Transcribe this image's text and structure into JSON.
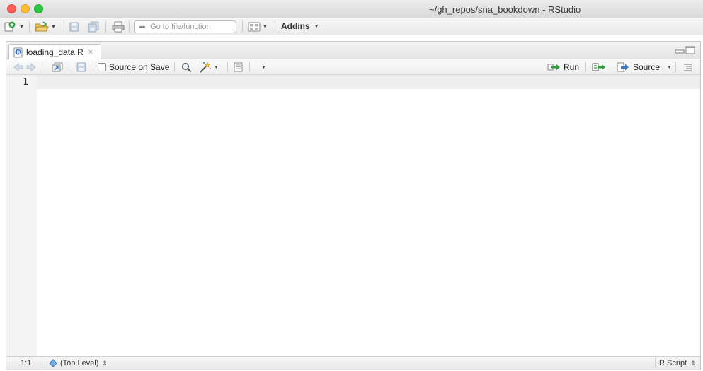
{
  "window": {
    "title": "~/gh_repos/sna_bookdown - RStudio"
  },
  "toolbar": {
    "goto_placeholder": "Go to file/function",
    "addins_label": "Addins",
    "icons": [
      "new-file-icon",
      "open-folder-icon",
      "save-icon",
      "save-all-icon",
      "print-icon",
      "workspace-panes-icon"
    ]
  },
  "editor_tab": {
    "filename": "loading_data.R",
    "close": "×"
  },
  "editor_toolbar": {
    "source_on_save": "Source on Save",
    "run": "Run",
    "source": "Source"
  },
  "editor": {
    "line_numbers": [
      "1"
    ]
  },
  "statusbar": {
    "position": "1:1",
    "scope": "(Top Level)",
    "filetype": "R Script"
  },
  "colors": {
    "accent_green": "#2e9e3e",
    "accent_blue": "#3b78c2"
  }
}
